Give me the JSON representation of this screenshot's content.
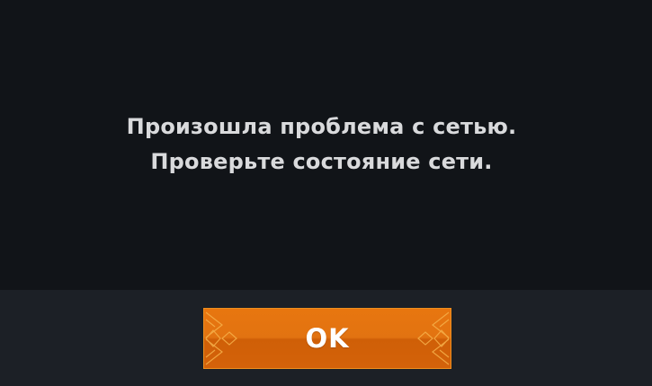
{
  "dialog": {
    "message_line_1": "Произошла проблема с сетью.",
    "message_line_2": "Проверьте состояние сети.",
    "ok_label": "OK"
  },
  "colors": {
    "background": "#111418",
    "footer": "#1c2026",
    "message_text": "#d9dadc",
    "button_orange": "#e27311",
    "button_text": "#ffffff"
  },
  "icons": {
    "button_ornament_left": "diamond-ornament-icon",
    "button_ornament_right": "diamond-ornament-icon"
  }
}
